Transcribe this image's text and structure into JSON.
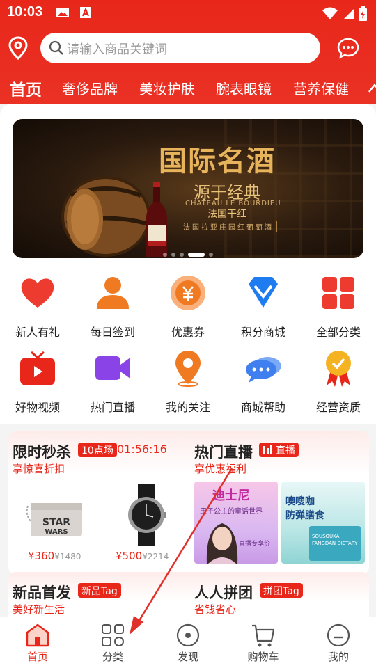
{
  "status_bar": {
    "time": "10:03"
  },
  "search": {
    "placeholder": "请输入商品关键词"
  },
  "category_tabs": [
    "首页",
    "奢侈品牌",
    "美妆护肤",
    "腕表眼镜",
    "营养保健"
  ],
  "banner": {
    "title": "国际名酒",
    "subtitle": "源于经典",
    "brand_en": "CHATEAU LE BOURDIEU",
    "brand_cn": "法国干红",
    "tagline": "法国拉亚庄园红葡萄酒",
    "page_count": 6,
    "active_page": 4
  },
  "quick_menu": [
    {
      "label": "新人有礼",
      "icon": "heart-icon"
    },
    {
      "label": "每日签到",
      "icon": "user-icon"
    },
    {
      "label": "优惠券",
      "icon": "coupon-icon"
    },
    {
      "label": "积分商城",
      "icon": "diamond-icon"
    },
    {
      "label": "全部分类",
      "icon": "grid-icon"
    },
    {
      "label": "好物视频",
      "icon": "tv-icon"
    },
    {
      "label": "热门直播",
      "icon": "video-camera-icon"
    },
    {
      "label": "我的关注",
      "icon": "location-pin-icon"
    },
    {
      "label": "商城帮助",
      "icon": "chat-bubble-icon"
    },
    {
      "label": "经营资质",
      "icon": "award-icon"
    }
  ],
  "flash_sale": {
    "title": "限时秒杀",
    "session_tag": "10点场",
    "countdown": "01:56:16",
    "subtitle": "享惊喜折扣",
    "products": [
      {
        "price": "¥360",
        "old_price": "¥1480"
      },
      {
        "price": "¥500",
        "old_price": "¥2214"
      }
    ]
  },
  "hot_live": {
    "title": "热门直播",
    "tag": "直播",
    "subtitle": "享优惠福利",
    "cards": [
      {
        "title_art": "迪士尼",
        "caption": "王子公主的童话世界",
        "line2": "直播专享价"
      },
      {
        "title_art": "噢嗖咖",
        "caption": "防弹膳食",
        "line2": "SOUSOUKA FANGDAN DIETARY"
      }
    ]
  },
  "new_arrivals": {
    "title": "新品首发",
    "tag": "新品Tag",
    "subtitle": "美好新生活"
  },
  "group_buy": {
    "title": "人人拼团",
    "tag": "拼团Tag",
    "subtitle": "省钱省心"
  },
  "bottom_nav": [
    {
      "label": "首页",
      "icon": "home-icon",
      "active": true
    },
    {
      "label": "分类",
      "icon": "category-icon",
      "active": false
    },
    {
      "label": "发现",
      "icon": "discover-icon",
      "active": false
    },
    {
      "label": "购物车",
      "icon": "cart-icon",
      "active": false
    },
    {
      "label": "我的",
      "icon": "profile-icon",
      "active": false
    }
  ],
  "colors": {
    "brand_red": "#e8271a",
    "text": "#222222"
  }
}
